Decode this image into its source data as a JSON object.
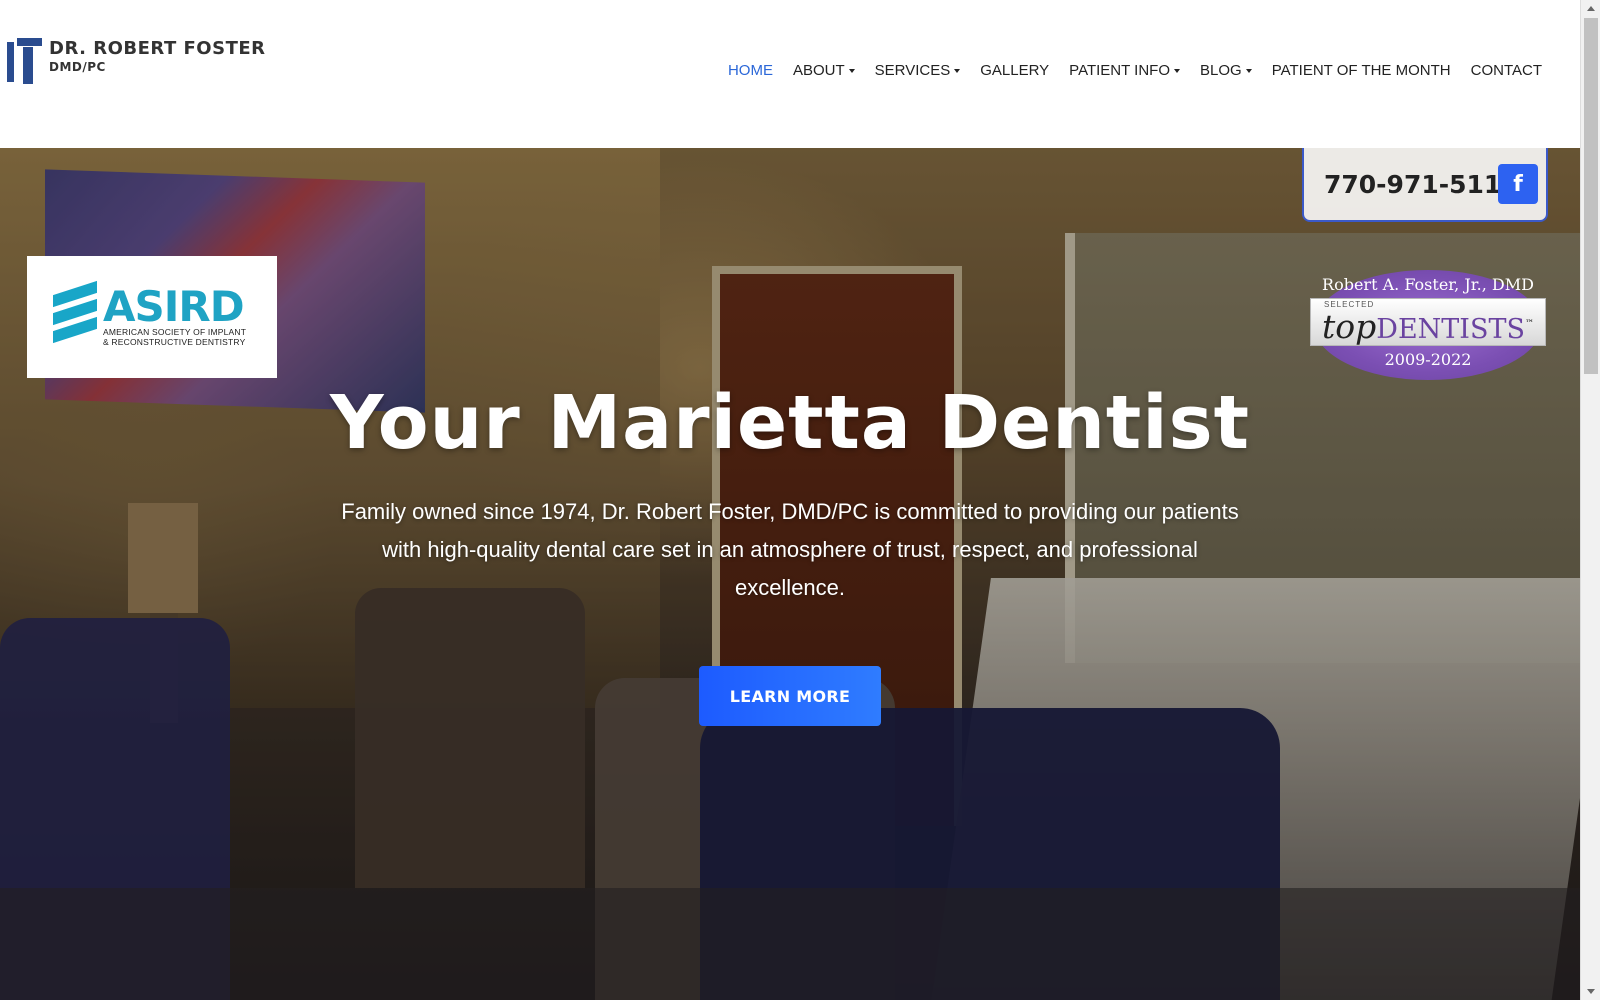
{
  "header": {
    "logo": {
      "name": "DR. ROBERT FOSTER",
      "sub": "DMD/PC"
    },
    "nav": [
      {
        "label": "HOME",
        "active": true,
        "dropdown": false
      },
      {
        "label": "ABOUT",
        "active": false,
        "dropdown": true
      },
      {
        "label": "SERVICES",
        "active": false,
        "dropdown": true
      },
      {
        "label": "GALLERY",
        "active": false,
        "dropdown": false
      },
      {
        "label": "PATIENT INFO",
        "active": false,
        "dropdown": true
      },
      {
        "label": "BLOG",
        "active": false,
        "dropdown": true
      },
      {
        "label": "PATIENT OF THE MONTH",
        "active": false,
        "dropdown": false
      },
      {
        "label": "CONTACT",
        "active": false,
        "dropdown": false
      }
    ]
  },
  "hero": {
    "title": "Your Marietta Dentist",
    "description": "Family owned since 1974, Dr. Robert Foster, DMD/PC is committed to providing our patients with high-quality dental care set in an atmosphere of trust, respect, and professional excellence.",
    "button": "LEARN MORE"
  },
  "contact": {
    "phone": "770-971-5119",
    "facebook_icon": "f"
  },
  "badges": {
    "asird": {
      "acronym": "ASIRD",
      "line1": "AMERICAN SOCIETY OF IMPLANT",
      "line2": "& RECONSTRUCTIVE DENTISTRY"
    },
    "top_dentists": {
      "name": "Robert A. Foster, Jr., DMD",
      "selected": "SELECTED",
      "brand_top": "top",
      "brand_dentists": "DENTISTS",
      "trademark": "™",
      "years": "2009-2022"
    }
  },
  "colors": {
    "accent": "#2b67d8",
    "button": "#1d5bff",
    "facebook": "#2d62f1",
    "logo": "#2a4c8f",
    "asird": "#1fa3c4",
    "badge_purple": "#7b4fb3"
  }
}
